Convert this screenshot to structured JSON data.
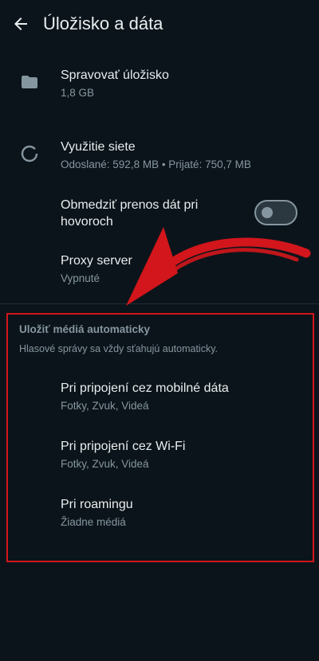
{
  "header": {
    "title": "Úložisko a dáta",
    "back_icon": "arrow-back-icon"
  },
  "settings": {
    "manage_storage": {
      "label": "Spravovať úložisko",
      "value": "1,8 GB",
      "icon": "folder-icon"
    },
    "network_usage": {
      "label": "Využitie siete",
      "value": "Odoslané: 592,8 MB • Prijaté: 750,7 MB",
      "icon": "data-usage-icon"
    },
    "less_data_calls": {
      "label_line1": "Obmedziť prenos dát pri",
      "label_line2": "hovoroch",
      "toggle_on": false
    },
    "proxy": {
      "label": "Proxy server",
      "value": "Vypnuté"
    }
  },
  "auto_download": {
    "title": "Uložiť médiá automaticky",
    "description": "Hlasové správy sa vždy sťahujú automaticky.",
    "items": [
      {
        "label": "Pri pripojení cez mobilné dáta",
        "value": "Fotky, Zvuk, Videá"
      },
      {
        "label": "Pri pripojení cez Wi-Fi",
        "value": "Fotky, Zvuk, Videá"
      },
      {
        "label": "Pri roamingu",
        "value": "Žiadne médiá"
      }
    ]
  },
  "colors": {
    "background": "#0b141a",
    "text_primary": "#e9edef",
    "text_secondary": "#8696a0",
    "annotation_red": "#d2161c"
  }
}
